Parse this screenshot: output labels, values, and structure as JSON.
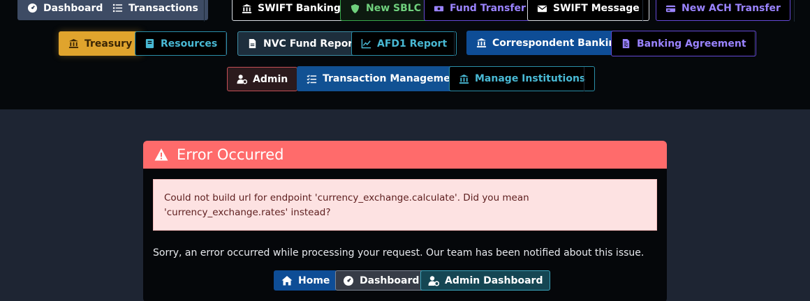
{
  "nav": {
    "row1": [
      {
        "id": "dashboard",
        "label": "Dashboard",
        "icon": "gauge-icon"
      },
      {
        "id": "transactions",
        "label": "Transactions",
        "icon": "list-icon"
      },
      {
        "id": "swift-banking",
        "label": "SWIFT Banking",
        "icon": "bank-icon"
      },
      {
        "id": "new-sblc",
        "label": "New SBLC",
        "icon": "shield-icon"
      },
      {
        "id": "fund-transfer",
        "label": "Fund Transfer",
        "icon": "money-icon"
      },
      {
        "id": "swift-message",
        "label": "SWIFT Message",
        "icon": "envelope-icon"
      },
      {
        "id": "new-ach-transfer",
        "label": "New ACH Transfer",
        "icon": "card-icon"
      }
    ],
    "row2": [
      {
        "id": "treasury",
        "label": "Treasury",
        "icon": "bank-icon"
      },
      {
        "id": "resources",
        "label": "Resources",
        "icon": "book-icon"
      },
      {
        "id": "nvc-fund-report",
        "label": "NVC Fund Report",
        "icon": "file-icon"
      },
      {
        "id": "afd1-report",
        "label": "AFD1 Report",
        "icon": "chart-line-icon"
      },
      {
        "id": "correspondent-banking",
        "label": "Correspondent Banking",
        "icon": "bank-icon"
      },
      {
        "id": "banking-agreement",
        "label": "Banking Agreement",
        "icon": "file-contract-icon"
      }
    ],
    "row3": [
      {
        "id": "admin",
        "label": "Admin",
        "icon": "user-cog-icon"
      },
      {
        "id": "transaction-management",
        "label": "Transaction Management",
        "icon": "tasks-icon"
      },
      {
        "id": "manage-institutions",
        "label": "Manage Institutions",
        "icon": "bank-icon"
      }
    ]
  },
  "error": {
    "title": "Error Occurred",
    "icon": "warning-icon",
    "detail": "Could not build url for endpoint 'currency_exchange.calculate'. Did you mean 'currency_exchange.rates' instead?",
    "message": "Sorry, an error occurred while processing your request. Our team has been notified about this issue.",
    "buttons": {
      "home": "Home",
      "dashboard": "Dashboard",
      "admin_dashboard": "Admin Dashboard"
    }
  },
  "colors": {
    "error_header": "#ff6b6b",
    "alert_bg": "#fde2e2",
    "primary": "#0e4d96",
    "treasury": "#e0a42d"
  }
}
